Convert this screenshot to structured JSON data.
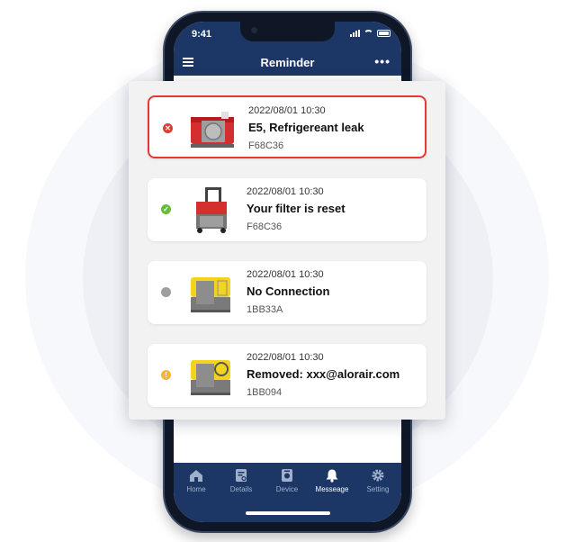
{
  "status_bar": {
    "time": "9:41"
  },
  "header": {
    "title": "Reminder"
  },
  "colors": {
    "primary": "#1c3766",
    "alert": "#e53935",
    "success": "#66bb3a",
    "offline": "#9e9e9e",
    "warning": "#f5b53a"
  },
  "reminders": [
    {
      "timestamp": "2022/08/01  10:30",
      "message": "E5, Refrigereant leak",
      "device_id": "F68C36",
      "status": "error",
      "device_color": "red"
    },
    {
      "timestamp": "2022/08/01  10:30",
      "message": "Your filter is reset",
      "device_id": "F68C36",
      "status": "success",
      "device_color": "red"
    },
    {
      "timestamp": "2022/08/01  10:30",
      "message": "No Connection",
      "device_id": "1BB33A",
      "status": "offline",
      "device_color": "yellow"
    },
    {
      "timestamp": "2022/08/01  10:30",
      "message": "Removed: xxx@alorair.com",
      "device_id": "1BB094",
      "status": "warning",
      "device_color": "yellow"
    }
  ],
  "tabs": [
    {
      "label": "Home",
      "icon": "home-icon"
    },
    {
      "label": "Details",
      "icon": "details-icon"
    },
    {
      "label": "Device",
      "icon": "device-icon"
    },
    {
      "label": "Messeage",
      "icon": "bell-icon",
      "active": true
    },
    {
      "label": "Setting",
      "icon": "gear-icon"
    }
  ]
}
